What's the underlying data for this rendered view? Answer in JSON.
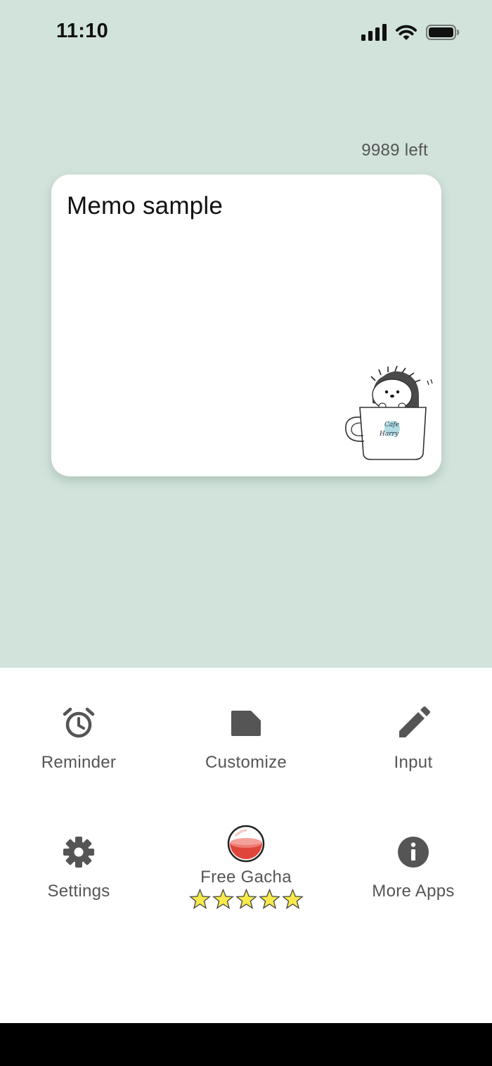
{
  "status_bar": {
    "time": "11:10",
    "icons": [
      "cellular-signal-icon",
      "wifi-icon",
      "battery-icon"
    ]
  },
  "memo": {
    "remaining": "9989 left",
    "text": "Memo sample",
    "illustration": "hedgehog-in-cup",
    "illustration_text": "Cafe Harry"
  },
  "menu": {
    "reminder": {
      "label": "Reminder",
      "icon": "alarm-clock-icon"
    },
    "customize": {
      "label": "Customize",
      "icon": "note-icon"
    },
    "input": {
      "label": "Input",
      "icon": "pencil-icon"
    },
    "settings": {
      "label": "Settings",
      "icon": "gear-icon"
    },
    "gacha": {
      "label": "Free Gacha",
      "icon": "capsule-icon",
      "stars": 5
    },
    "more_apps": {
      "label": "More Apps",
      "icon": "info-icon"
    }
  },
  "colors": {
    "background": "#d1e3db",
    "card": "#ffffff",
    "icon": "#555555",
    "star": "#f7ea4a",
    "capsule": "#e0453c"
  }
}
